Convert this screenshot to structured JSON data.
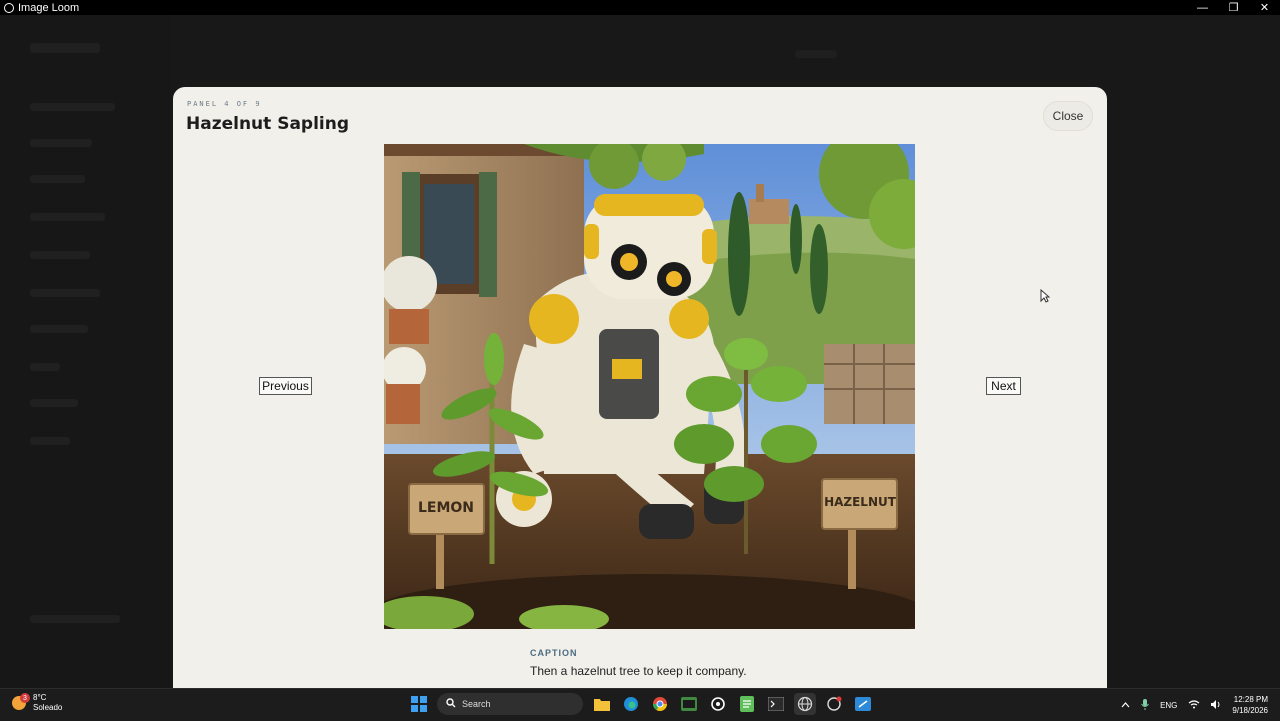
{
  "window": {
    "title": "Image Loom",
    "minimize_glyph": "—",
    "restore_glyph": "❐",
    "close_glyph": "✕"
  },
  "modal": {
    "panel_label": "PANEL 4 OF 9",
    "title": "Hazelnut Sapling",
    "close_label": "Close",
    "previous_label": "Previous",
    "next_label": "Next",
    "caption_label": "CAPTION",
    "caption_text": "Then a hazelnut tree to keep it company.",
    "picture_signs": {
      "left": "LEMON",
      "right": "HAZELNUT"
    }
  },
  "taskbar": {
    "weather_temp": "8°C",
    "weather_desc": "Soleado",
    "weather_badge": "3",
    "search_placeholder": "Search",
    "language": "ENG",
    "time": "12:28 PM",
    "date": "9/18/2026"
  },
  "colors": {
    "modal_bg": "#f2f0ea",
    "caption_label": "#4a6b80",
    "taskbar_bg": "#1c1c1c"
  }
}
